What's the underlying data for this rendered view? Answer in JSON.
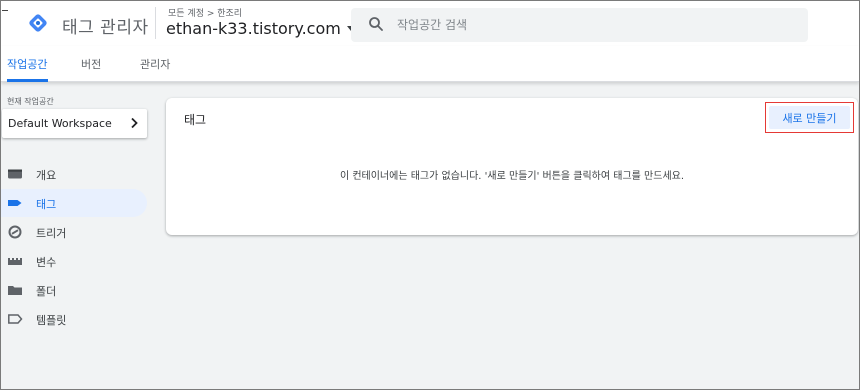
{
  "header": {
    "app_title": "태그 관리자",
    "account_path": "모든 계정 > 한조리",
    "container_name": "ethan-k33.tistory.com",
    "search_placeholder": "작업공간 검색"
  },
  "tabs": [
    {
      "label": "작업공간",
      "active": true
    },
    {
      "label": "버전",
      "active": false
    },
    {
      "label": "관리자",
      "active": false
    }
  ],
  "sidebar": {
    "workspace_label": "현재 작업공간",
    "workspace_name": "Default Workspace",
    "items": [
      {
        "label": "개요",
        "icon": "overview-icon",
        "active": false
      },
      {
        "label": "태그",
        "icon": "tag-icon",
        "active": true
      },
      {
        "label": "트리거",
        "icon": "trigger-icon",
        "active": false
      },
      {
        "label": "변수",
        "icon": "variable-icon",
        "active": false
      },
      {
        "label": "폴더",
        "icon": "folder-icon",
        "active": false
      },
      {
        "label": "템플릿",
        "icon": "template-icon",
        "active": false
      }
    ]
  },
  "main": {
    "card_title": "태그",
    "new_button_label": "새로 만들기",
    "empty_message": "이 컨테이너에는 태그가 없습니다. '새로 만들기' 버튼을 클릭하여 태그를 만드세요."
  },
  "colors": {
    "accent": "#1a73e8",
    "active_bg": "#e8f0fe",
    "highlight_border": "#e53935",
    "page_bg": "#f1f3f4"
  }
}
